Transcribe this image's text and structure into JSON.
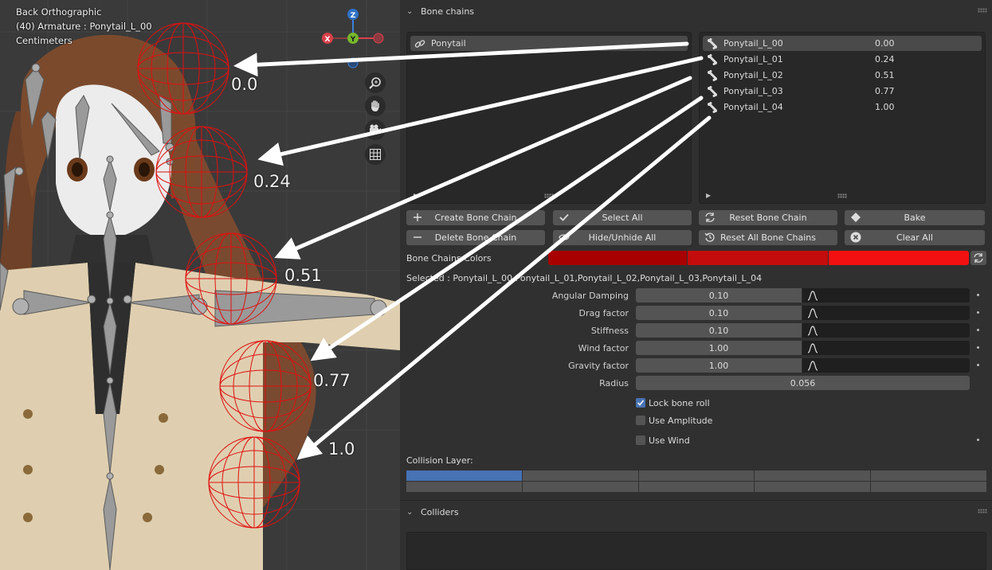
{
  "viewport": {
    "view_name": "Back Orthographic",
    "object_info": "(40) Armature : Ponytail_L_00",
    "units": "Centimeters",
    "gizmo": {
      "z": "Z",
      "y": "Y",
      "x": "X"
    },
    "annotations": [
      "0.0",
      "0.24",
      "0.51",
      "0.77",
      "1.0"
    ],
    "nav_icons": [
      "zoom-icon",
      "hand-pan-icon",
      "camera-icon",
      "grid-icon"
    ]
  },
  "bone_chains": {
    "section_title": "Bone chains",
    "chains": [
      {
        "label": "Ponytail"
      }
    ],
    "bones": [
      {
        "name": "Ponytail_L_00",
        "value": "0.00"
      },
      {
        "name": "Ponytail_L_01",
        "value": "0.24"
      },
      {
        "name": "Ponytail_L_02",
        "value": "0.51"
      },
      {
        "name": "Ponytail_L_03",
        "value": "0.77"
      },
      {
        "name": "Ponytail_L_04",
        "value": "1.00"
      }
    ],
    "buttons": {
      "create": "Create Bone Chain",
      "select_all": "Select All",
      "reset": "Reset Bone Chain",
      "bake": "Bake",
      "delete": "Delete Bone Chain",
      "hide_unhide": "Hide/Unhide All",
      "reset_all": "Reset All Bone Chains",
      "clear_all": "Clear All"
    },
    "colors_label": "Bone Chains Colors",
    "colors": [
      "#a80000",
      "#c50c0c",
      "#f21010"
    ],
    "selected_text": "Selected : Ponytail_L_00,Ponytail_L_01,Ponytail_L_02,Ponytail_L_03,Ponytail_L_04",
    "properties": [
      {
        "label": "Angular Damping",
        "value": "0.10"
      },
      {
        "label": "Drag factor",
        "value": "0.10"
      },
      {
        "label": "Stiffness",
        "value": "0.10"
      },
      {
        "label": "Wind factor",
        "value": "1.00"
      },
      {
        "label": "Gravity factor",
        "value": "1.00"
      }
    ],
    "radius": {
      "label": "Radius",
      "value": "0.056"
    },
    "checkboxes": [
      {
        "label": "Lock bone roll",
        "checked": true
      },
      {
        "label": "Use Amplitude",
        "checked": false
      },
      {
        "label": "Use Wind",
        "checked": false
      }
    ],
    "collision_layer_label": "Collision Layer:",
    "collision_layers_active": [
      1
    ]
  },
  "colliders": {
    "section_title": "Colliders"
  }
}
